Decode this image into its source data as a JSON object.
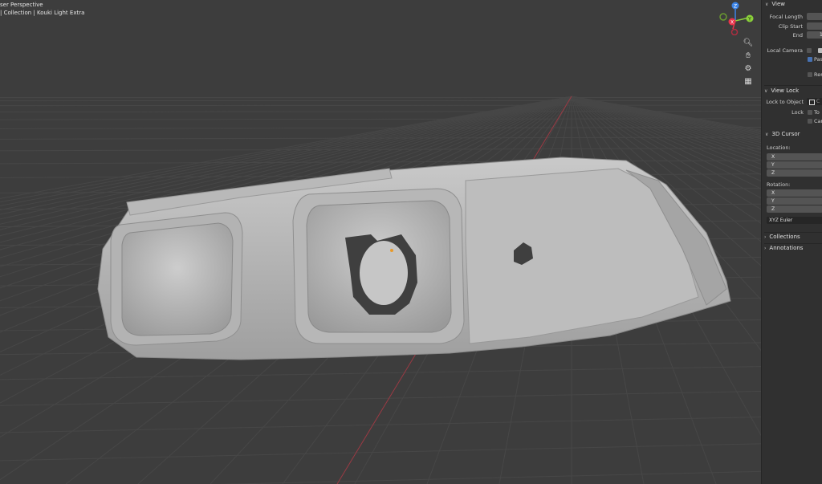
{
  "overlay": {
    "view_name": "ser Perspective",
    "breadcrumb": "| Collection | Kouki Light Extra"
  },
  "gizmo": {
    "z_label": "Z",
    "y_label": "Y",
    "x_label": "X",
    "colors": {
      "x": "#e8344a",
      "y": "#8bd13a",
      "z": "#3c84e6"
    }
  },
  "nav_icons": [
    "zoom-icon",
    "hand-pan-icon",
    "camera-toggle-icon",
    "grid-perspective-icon"
  ],
  "panel": {
    "view": {
      "title": "View",
      "focal_length_label": "Focal Length",
      "clip_start_label": "Clip Start",
      "end_label": "End",
      "end_value": "1",
      "local_camera_label": "Local Camera",
      "passepartout_label": "Pas",
      "render_region_label": "Ren"
    },
    "view_lock": {
      "title": "View Lock",
      "lock_to_object_label": "Lock to Object",
      "lock_to_object_value": "C",
      "lock_label": "Lock",
      "to3d_label": "To",
      "camera_label": "Can"
    },
    "cursor": {
      "title": "3D Cursor",
      "location_label": "Location:",
      "rotation_label": "Rotation:",
      "x": "X",
      "y": "Y",
      "z": "Z",
      "rotation_mode": "XYZ Euler"
    },
    "collections_label": "Collections",
    "annotations_label": "Annotations"
  }
}
